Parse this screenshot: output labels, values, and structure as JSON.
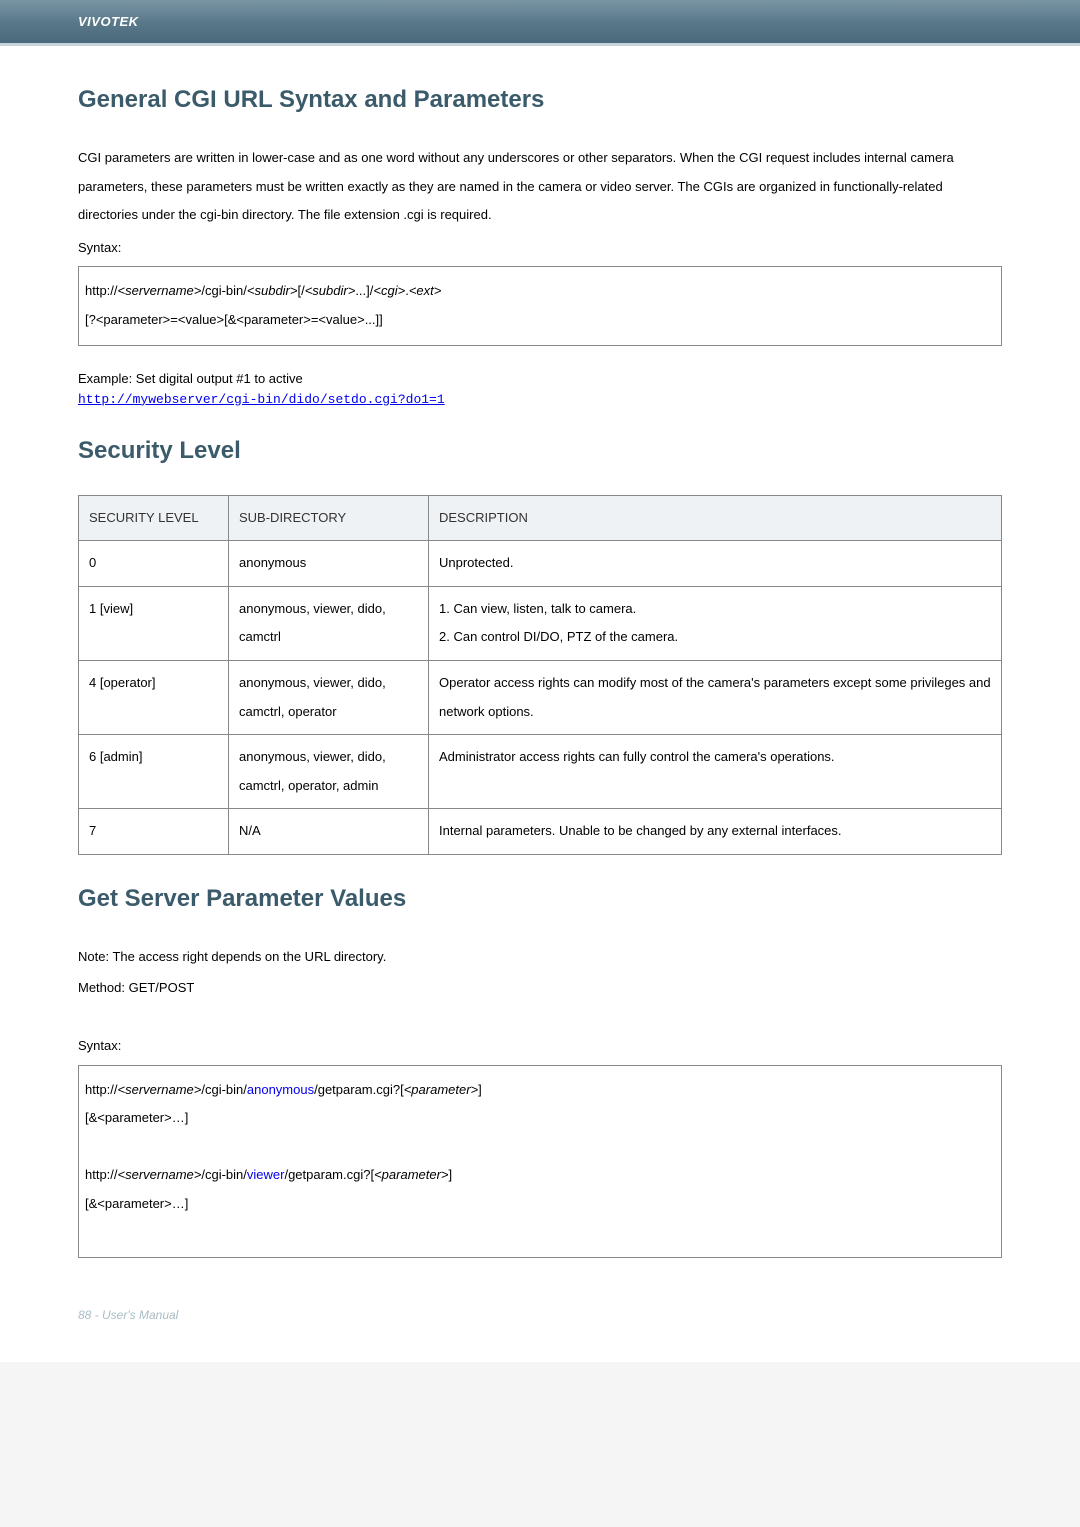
{
  "header": {
    "brand": "VIVOTEK"
  },
  "sections": {
    "s1": {
      "title": "General CGI URL Syntax and Parameters",
      "para": "CGI parameters are written in lower-case and as one word without any underscores or other separators. When the CGI request includes internal camera parameters, these parameters must be written exactly as they are named in the camera or video server. The CGIs are organized in functionally-related directories under the cgi-bin directory. The file extension .cgi is required.",
      "syntax_label": "Syntax:",
      "code": {
        "pre1": "http://",
        "srv": "<servername>",
        "mid1": "/cgi-bin/",
        "sub1": "<subdir>",
        "mid2": "[/",
        "sub2": "<subdir>",
        "mid3": "...]/",
        "cgi": "<cgi>",
        "dot": ".",
        "ext": "<ext>",
        "line2": "[?<parameter>=<value>[&<parameter>=<value>...]]"
      },
      "example_label": "Example: Set digital output #1 to active",
      "example_link": "http://mywebserver/cgi-bin/dido/setdo.cgi?do1=1"
    },
    "s2": {
      "title": "Security Level",
      "headers": [
        "SECURITY LEVEL",
        "SUB-DIRECTORY",
        "DESCRIPTION"
      ],
      "rows": [
        {
          "level": "0",
          "subdir": "anonymous",
          "desc": "Unprotected."
        },
        {
          "level": "1 [view]",
          "subdir": "anonymous, viewer, dido, camctrl",
          "desc": "1. Can view, listen, talk to camera.\n2. Can control DI/DO, PTZ of the camera."
        },
        {
          "level": "4 [operator]",
          "subdir": "anonymous, viewer, dido, camctrl, operator",
          "desc": "Operator access rights can modify most of the camera's parameters except some privileges and network options."
        },
        {
          "level": "6 [admin]",
          "subdir": "anonymous, viewer, dido, camctrl, operator, admin",
          "desc": "Administrator access rights can fully control the camera's operations."
        },
        {
          "level": "7",
          "subdir": "N/A",
          "desc": "Internal parameters. Unable to be changed by any external interfaces."
        }
      ]
    },
    "s3": {
      "title": "Get Server Parameter Values",
      "note": "Note: The access right depends on the URL directory.",
      "method": "Method: GET/POST",
      "syntax_label": "Syntax:",
      "code": {
        "l1_pre": "http://",
        "l1_srv": "<servername>",
        "l1_mid": "/cgi-bin/",
        "l1_blue": "anonymous",
        "l1_post": "/getparam.cgi?[",
        "l1_param": "<parameter>",
        "l1_end": "]",
        "l2": "[&<parameter>…]",
        "l3_pre": "http://",
        "l3_srv": "<servername>",
        "l3_mid": "/cgi-bin/",
        "l3_blue": "viewer",
        "l3_post": "/getparam.cgi?[",
        "l3_param": "<parameter>",
        "l3_end": "]",
        "l4": "[&<parameter>…]"
      }
    }
  },
  "footer": {
    "page": "88 - User's Manual"
  }
}
